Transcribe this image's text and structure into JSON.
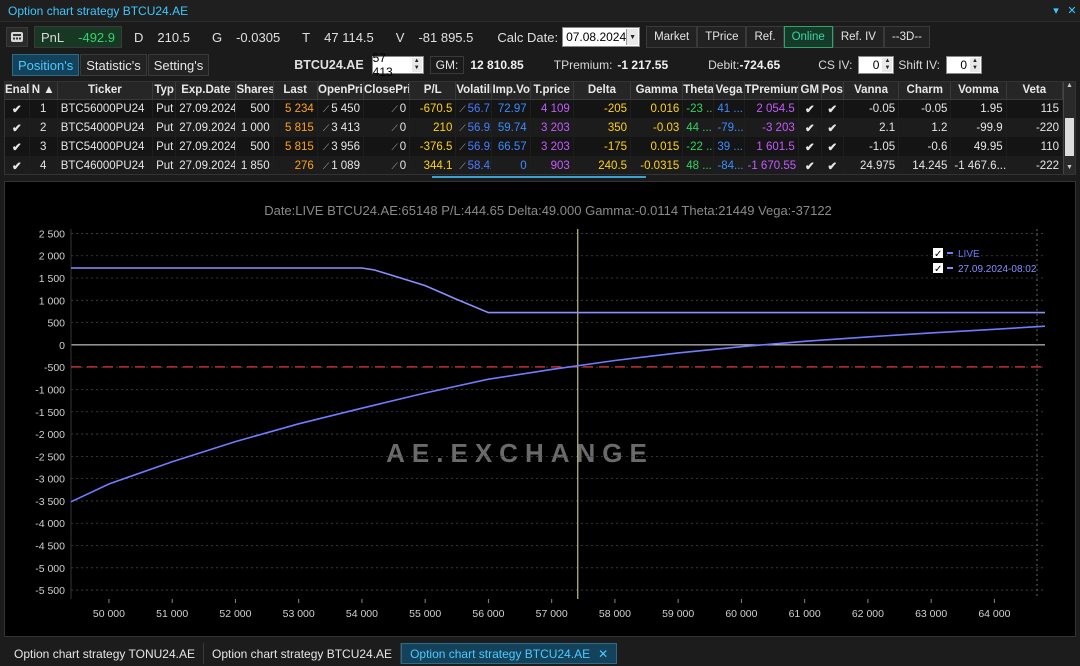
{
  "window": {
    "title": "Option chart strategy BTCU24.AE"
  },
  "toolbar": {
    "pnl_label": "PnL",
    "pnl_value": "-492.9",
    "d_label": "D",
    "d_value": "210.5",
    "g_label": "G",
    "g_value": "-0.0305",
    "t_label": "T",
    "t_value": "47 114.5",
    "v_label": "V",
    "v_value": "-81 895.5",
    "calc_label": "Calc Date:",
    "calc_value": "07.08.2024",
    "buttons": [
      "Market",
      "TPrice",
      "Ref.",
      "Online",
      "Ref. IV",
      "--3D--"
    ],
    "active_button": "Online"
  },
  "tabs": {
    "items": [
      "Position's",
      "Statistic's",
      "Setting's"
    ],
    "active": "Position's"
  },
  "infobar": {
    "symbol": "BTCU24.AE",
    "symbol_price": "57 413",
    "gm_label": "GM:",
    "gm_value": "12 810.85",
    "tpremium_label": "TPremium:",
    "tpremium_value": "-1 217.55",
    "debit_label": "Debit:",
    "debit_value": "-724.65",
    "csiv_label": "CS IV:",
    "csiv_value": "0",
    "shiftiv_label": "Shift IV:",
    "shiftiv_value": "0"
  },
  "grid": {
    "columns": [
      "Enal",
      "N",
      "Ticker",
      "Typ",
      "Exp.Date",
      "Shares",
      "Last",
      "OpenPri",
      "ClosePri",
      "P/L",
      "Volatili",
      "Imp.Vo",
      "T.price",
      "Delta",
      "Gamma",
      "Theta",
      "Vega",
      "TPremium",
      "GM",
      "Pos",
      "Vanna",
      "Charm",
      "Vomma",
      "Veta"
    ],
    "sort_arrow": "▲",
    "rows": [
      {
        "n": "1",
        "ticker": "BTC56000PU24",
        "type": "Put",
        "exp": "27.09.2024",
        "shares": "500",
        "last": "5 234",
        "open": "5 450",
        "close": "0",
        "pl": "-670.5",
        "vol": "56.71",
        "imp": "72.97",
        "tprice": "4 109",
        "delta": "-205",
        "gamma": "0.016",
        "theta": "-23 ...",
        "vega": "41 ...",
        "tprem": "2 054.5",
        "vanna": "-0.05",
        "charm": "-0.05",
        "vomma": "1.95",
        "veta": "115"
      },
      {
        "n": "2",
        "ticker": "BTC54000PU24",
        "type": "Put",
        "exp": "27.09.2024",
        "shares": "1 000",
        "last": "5 815",
        "open": "3 413",
        "close": "0",
        "pl": "210",
        "vol": "56.92",
        "imp": "59.74",
        "tprice": "3 203",
        "delta": "350",
        "gamma": "-0.03",
        "theta": "44 ...",
        "vega": "-79...",
        "tprem": "-3 203",
        "vanna": "2.1",
        "charm": "1.2",
        "vomma": "-99.9",
        "veta": "-220"
      },
      {
        "n": "3",
        "ticker": "BTC54000PU24",
        "type": "Put",
        "exp": "27.09.2024",
        "shares": "500",
        "last": "5 815",
        "open": "3 956",
        "close": "0",
        "pl": "-376.5",
        "vol": "56.92",
        "imp": "66.57",
        "tprice": "3 203",
        "delta": "-175",
        "gamma": "0.015",
        "theta": "-22 ...",
        "vega": "39 ...",
        "tprem": "1 601.5",
        "vanna": "-1.05",
        "charm": "-0.6",
        "vomma": "49.95",
        "veta": "110"
      },
      {
        "n": "4",
        "ticker": "BTC46000PU24",
        "type": "Put",
        "exp": "27.09.2024",
        "shares": "1 850",
        "last": "276",
        "open": "1 089",
        "close": "0",
        "pl": "344.1",
        "vol": "58.42",
        "imp": "0",
        "tprice": "903",
        "delta": "240.5",
        "gamma": "-0.0315",
        "theta": "48 ...",
        "vega": "-84...",
        "tprem": "-1 670.55",
        "vanna": "24.975",
        "charm": "14.245",
        "vomma": "-1 467.6...",
        "veta": "-222"
      }
    ]
  },
  "chart_data": {
    "type": "line",
    "title": "Date:LIVE  BTCU24.AE:65148  P/L:444.65  Delta:49.000  Gamma:-0.0114  Theta:21449  Vega:-37122",
    "watermark": "AE.EXCHANGE",
    "xlabel": "",
    "ylabel": "",
    "xlim": [
      49400,
      64800
    ],
    "ylim": [
      -5700,
      2600
    ],
    "x_ticks": [
      50000,
      51000,
      52000,
      53000,
      54000,
      55000,
      56000,
      57000,
      58000,
      59000,
      60000,
      61000,
      62000,
      63000,
      64000
    ],
    "y_ticks": [
      2500,
      2000,
      1500,
      1000,
      500,
      0,
      -500,
      -1000,
      -1500,
      -2000,
      -2500,
      -3000,
      -3500,
      -4000,
      -4500,
      -5000,
      -5500
    ],
    "grid": true,
    "legend_position": "top-right",
    "current_price_x": 57413,
    "break_even_y": -492.9,
    "series": [
      {
        "name": "LIVE",
        "color": "#6f7cff",
        "x": [
          49400,
          50000,
          51000,
          52000,
          53000,
          54000,
          55000,
          56000,
          57000,
          58000,
          59000,
          60000,
          61000,
          62000,
          63000,
          64000,
          64800
        ],
        "y": [
          -3520,
          -3120,
          -2620,
          -2170,
          -1770,
          -1420,
          -1080,
          -770,
          -550,
          -350,
          -180,
          -40,
          80,
          180,
          270,
          350,
          420
        ]
      },
      {
        "name": "27.09.2024-08:02",
        "color": "#8a8fff",
        "x": [
          49400,
          50000,
          51000,
          52000,
          53000,
          54000,
          54200,
          55000,
          55500,
          56000,
          57000,
          58000,
          59000,
          60000,
          61000,
          62000,
          63000,
          64000,
          64800
        ],
        "y": [
          1725,
          1725,
          1725,
          1725,
          1725,
          1725,
          1680,
          1330,
          1020,
          725,
          725,
          725,
          725,
          725,
          725,
          725,
          725,
          725,
          725
        ]
      }
    ]
  },
  "bottom_tabs": {
    "items": [
      "Option chart strategy TONU24.AE",
      "Option chart strategy BTCU24.AE",
      "Option chart strategy BTCU24.AE"
    ],
    "active_index": 2,
    "close": "✕"
  },
  "icons": {
    "close": "close-icon",
    "pin": "pin-icon",
    "calculator": "calculator-icon"
  }
}
